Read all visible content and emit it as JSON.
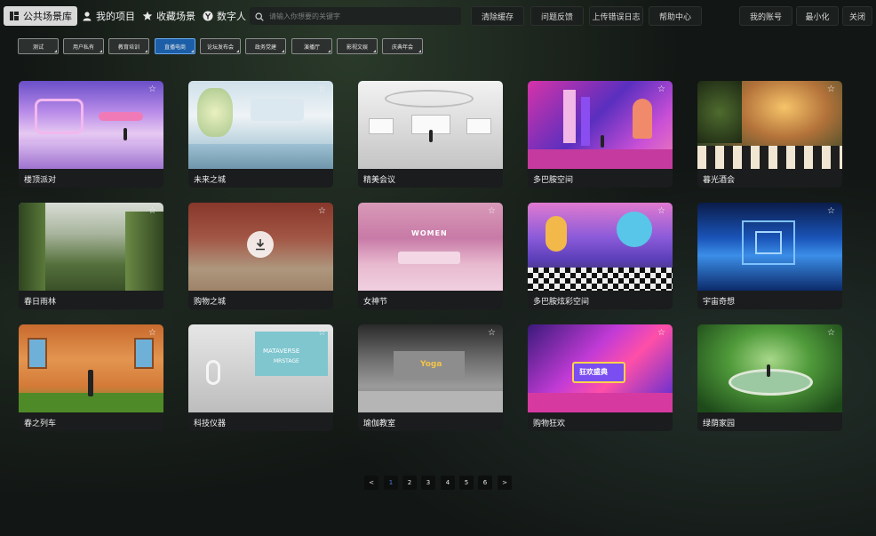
{
  "nav": {
    "tabs": [
      {
        "label": "公共场景库",
        "icon": "library-icon"
      },
      {
        "label": "我的项目",
        "icon": "user-icon"
      },
      {
        "label": "收藏场景",
        "icon": "star-icon"
      },
      {
        "label": "数字人",
        "icon": "digital-human-icon"
      }
    ],
    "search_placeholder": "请输入你想要的关键字"
  },
  "toolbar": {
    "clear_cache": "清除缓存",
    "feedback": "问题反馈",
    "upload_log": "上传错误日志",
    "help": "帮助中心",
    "account": "我的账号",
    "minimize": "最小化",
    "close": "关闭"
  },
  "categories": [
    "测试",
    "用户私有",
    "教育培训",
    "直播电商",
    "论坛发布会",
    "政务党建",
    "演播厅",
    "影视文娱",
    "庆典年会"
  ],
  "active_category": "直播电商",
  "scenes": [
    {
      "name": "楼顶派对"
    },
    {
      "name": "未来之城"
    },
    {
      "name": "精美会议"
    },
    {
      "name": "多巴胺空间"
    },
    {
      "name": "暮光酒会"
    },
    {
      "name": "春日雨林"
    },
    {
      "name": "购物之城"
    },
    {
      "name": "女神节"
    },
    {
      "name": "多巴胺炫彩空间"
    },
    {
      "name": "宇宙奇想"
    },
    {
      "name": "春之列车"
    },
    {
      "name": "科技仪器"
    },
    {
      "name": "瑜伽教室"
    },
    {
      "name": "购物狂欢"
    },
    {
      "name": "绿荫家园"
    }
  ],
  "thumb_text": {
    "women": "WOMEN",
    "mataverse": "MATAVERSE",
    "mrstage": "MRSTAGE",
    "yoga": "Yoga",
    "kuanghuan": "狂欢盛典"
  },
  "pagination": {
    "prev": "<",
    "pages": [
      "1",
      "2",
      "3",
      "4",
      "5",
      "6"
    ],
    "current": "1",
    "next": ">"
  }
}
